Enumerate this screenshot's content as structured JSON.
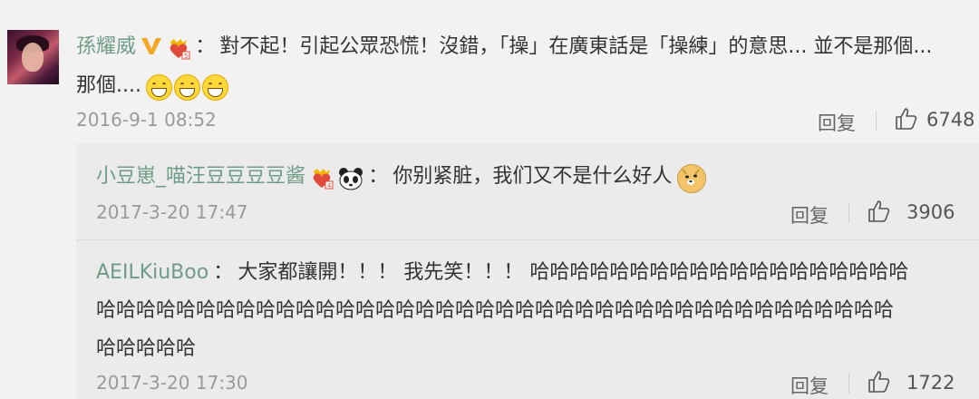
{
  "comments": [
    {
      "username": "孫耀威",
      "separator": "：",
      "text_line1": "對不起！引起公眾恐慌！沒錯，「操」在廣東話是「操練」的意思... 並不是那個...",
      "text_line2": "那個....",
      "timestamp": "2016-9-1 08:52",
      "reply_label": "回复",
      "likes": "6748"
    },
    {
      "username": "小豆崽_喵汪豆豆豆豆酱",
      "separator": "：",
      "text": "你别紧脏，我们又不是什么好人",
      "timestamp": "2017-3-20 17:47",
      "reply_label": "回复",
      "likes": "3906"
    },
    {
      "username": "AEILKiuBoo",
      "separator": "：",
      "text_line1": "大家都讓開！！！ 我先笑！！！ 哈哈哈哈哈哈哈哈哈哈哈哈哈哈哈哈哈哈哈",
      "text_line2": "哈哈哈哈哈哈哈哈哈哈哈哈哈哈哈哈哈哈哈哈哈哈哈哈哈哈哈哈哈哈哈哈哈哈哈哈哈哈哈哈",
      "text_line3": "哈哈哈哈哈",
      "timestamp": "2017-3-20 17:30",
      "reply_label": "回复",
      "likes": "1722"
    }
  ],
  "colors": {
    "username": "#6e9c86",
    "timestamp": "#9a9a9a",
    "background": "#f2f2f2",
    "nested_background": "#ebebeb"
  }
}
